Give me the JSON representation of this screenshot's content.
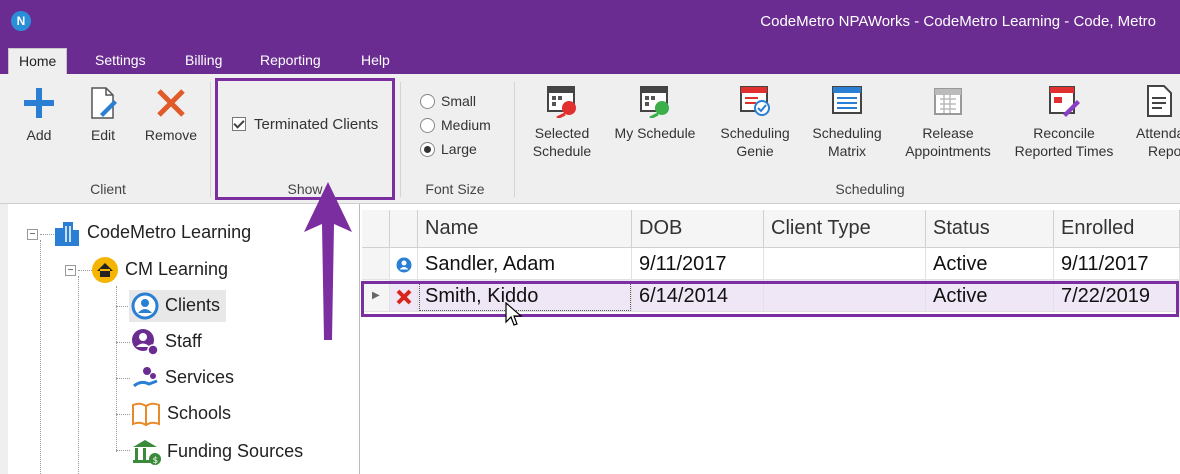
{
  "app": {
    "logo_letter": "N",
    "title": "CodeMetro NPAWorks - CodeMetro Learning - Code, Metro"
  },
  "menu": [
    "Home",
    "Settings",
    "Billing",
    "Reporting",
    "Help"
  ],
  "ribbon": {
    "client_group": {
      "label": "Client",
      "add": "Add",
      "edit": "Edit",
      "remove": "Remove"
    },
    "show_group": {
      "label": "Show",
      "terminated": "Terminated Clients",
      "terminated_checked": true
    },
    "font_group": {
      "label": "Font Size",
      "options": [
        "Small",
        "Medium",
        "Large"
      ],
      "selected": "Large"
    },
    "scheduling_group": {
      "label": "Scheduling",
      "buttons": [
        {
          "line1": "Selected",
          "line2": "Schedule"
        },
        {
          "line1": "My Schedule",
          "line2": ""
        },
        {
          "line1": "Scheduling",
          "line2": "Genie"
        },
        {
          "line1": "Scheduling",
          "line2": "Matrix"
        },
        {
          "line1": "Release",
          "line2": "Appointments"
        },
        {
          "line1": "Reconcile",
          "line2": "Reported Times"
        },
        {
          "line1": "Attenda",
          "line2": "Repo"
        }
      ]
    }
  },
  "tree": {
    "root": "CodeMetro Learning",
    "org": "CM Learning",
    "items": [
      "Clients",
      "Staff",
      "Services",
      "Schools",
      "Funding Sources"
    ],
    "selected": "Clients"
  },
  "grid": {
    "columns": [
      "Name",
      "DOB",
      "Client Type",
      "Status",
      "Enrolled"
    ],
    "rows": [
      {
        "name": "Sandler, Adam",
        "dob": "9/11/2017",
        "client_type": "",
        "status": "Active",
        "enrolled": "9/11/2017",
        "icon": "active-client-icon"
      },
      {
        "name": "Smith, Kiddo",
        "dob": "6/14/2014",
        "client_type": "",
        "status": "Active",
        "enrolled": "7/22/2019",
        "icon": "terminated-client-icon"
      }
    ]
  },
  "colors": {
    "brand_purple": "#6b2c91",
    "highlight": "#7b2ea0",
    "selected_row": "#efe6f6"
  }
}
